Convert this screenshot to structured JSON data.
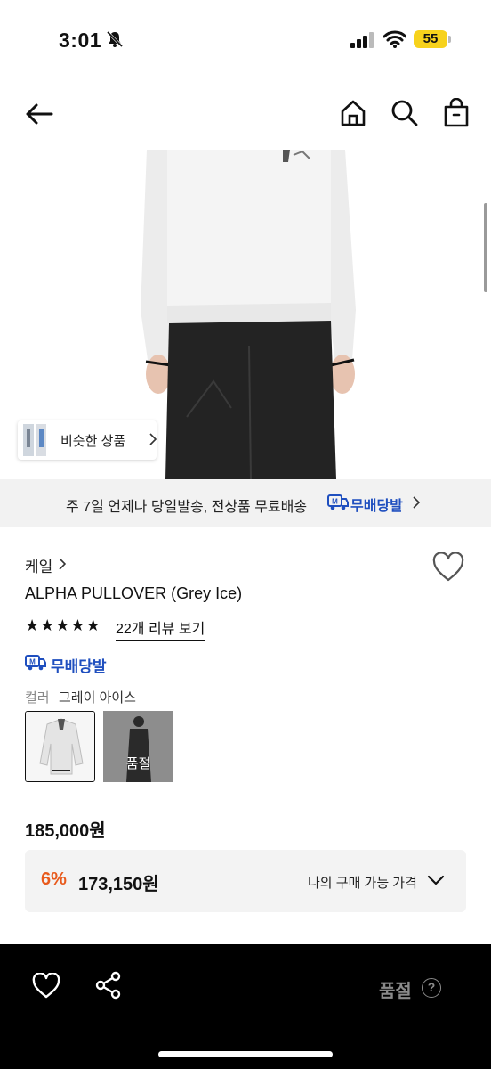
{
  "status_bar": {
    "time": "3:01",
    "battery": "55"
  },
  "similar_products": {
    "label": "비슷한 상품"
  },
  "delivery_banner": {
    "text": "주 7일 언제나 당일발송, 전상품 무료배송",
    "badge": "무배당발"
  },
  "product": {
    "brand": "케일",
    "title": "ALPHA PULLOVER (Grey Ice)",
    "rating_stars": 5,
    "reviews_label": "22개 리뷰 보기",
    "free_delivery_badge": "무배당발",
    "color_label": "컬러",
    "color_value": "그레이 아이스",
    "variant_soldout_label": "품절",
    "price": "185,000원",
    "discount_percent": "6%",
    "sale_price": "173,150원",
    "my_price_label": "나의 구매 가능 가격"
  },
  "bottom_bar": {
    "soldout_label": "품절",
    "help_icon": "?"
  },
  "colors": {
    "accent_blue": "#1f4fbf",
    "discount_orange": "#e85a1c"
  }
}
